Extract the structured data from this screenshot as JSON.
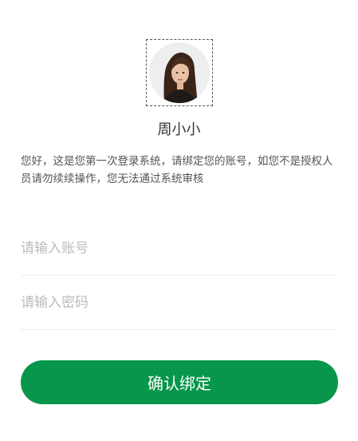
{
  "profile": {
    "avatar_icon": "user-photo-avatar",
    "name": "周小小"
  },
  "notice": {
    "text": "您好，这是您第一次登录系统，请绑定您的账号，如您不是授权人员请勿续续操作，您无法通过系统审核"
  },
  "form": {
    "account_placeholder": "请输入账号",
    "account_value": "",
    "password_placeholder": "请输入密码",
    "password_value": ""
  },
  "actions": {
    "confirm_label": "确认绑定",
    "confirm_color": "#07964a"
  }
}
